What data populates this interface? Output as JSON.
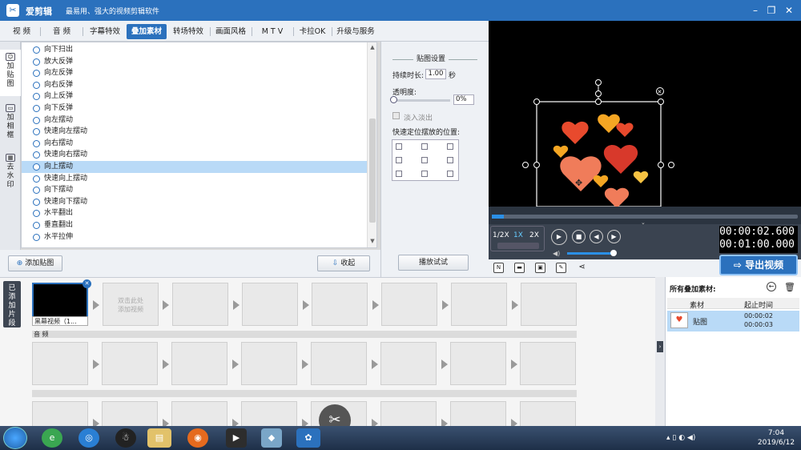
{
  "app": {
    "name": "爱剪辑",
    "slogan": "最易用、强大的视频剪辑软件"
  },
  "tabs": [
    "视  频",
    "音  频",
    "字幕特效",
    "叠加素材",
    "转场特效",
    "画面风格",
    "M T V",
    "卡拉OK",
    "升级与服务"
  ],
  "active_tab": "叠加素材",
  "side_tabs": [
    {
      "label": "加\n贴\n图"
    },
    {
      "label": "加\n相\n框"
    },
    {
      "label": "去\n水\n印"
    }
  ],
  "effects": [
    {
      "label": "向下扫出"
    },
    {
      "label": "放大反弹"
    },
    {
      "label": "向左反弹"
    },
    {
      "label": "向右反弹"
    },
    {
      "label": "向上反弹"
    },
    {
      "label": "向下反弹"
    },
    {
      "label": "向左摆动"
    },
    {
      "label": "快速向左摆动"
    },
    {
      "label": "向右摆动"
    },
    {
      "label": "快速向右摆动"
    },
    {
      "label": "向上摆动",
      "selected": true
    },
    {
      "label": "快速向上摆动"
    },
    {
      "label": "向下摆动"
    },
    {
      "label": "快速向下摆动"
    },
    {
      "label": "水平翻出"
    },
    {
      "label": "垂直翻出"
    },
    {
      "label": "水平拉伸"
    }
  ],
  "left_buttons": {
    "add_sticker": "添加贴图",
    "collapse": "收起"
  },
  "settings": {
    "title": "贴图设置",
    "duration_label": "持续时长:",
    "duration_value": "1.00",
    "duration_unit": "秒",
    "opacity_label": "透明度:",
    "opacity_value": "0%",
    "fade_label": "淡入淡出",
    "position_label": "快速定位摆放的位置:",
    "play_test": "播放试试"
  },
  "player": {
    "speeds": [
      "1/2X",
      "1X",
      "2X"
    ],
    "active_speed": "1X",
    "time_current": "00:00:02.600",
    "time_total": "00:01:00.000",
    "progress": 0.04,
    "export_label": "导出视频"
  },
  "timeline": {
    "added_label": "已\n添\n加\n片\n段",
    "first_clip": "黑幕视频（1...",
    "placeholder": "双击此处\n添加视频",
    "audio_label": "音  频"
  },
  "overlay_panel": {
    "title": "所有叠加素材:",
    "col_material": "素材",
    "col_time": "起止时间",
    "row_name": "贴图",
    "row_start": "00:00:02",
    "row_end": "00:00:03"
  },
  "taskbar": {
    "time": "7:04",
    "date": "2019/6/12"
  },
  "colors": {
    "accent": "#2b71bd",
    "selected_row": "#b9daf7"
  }
}
